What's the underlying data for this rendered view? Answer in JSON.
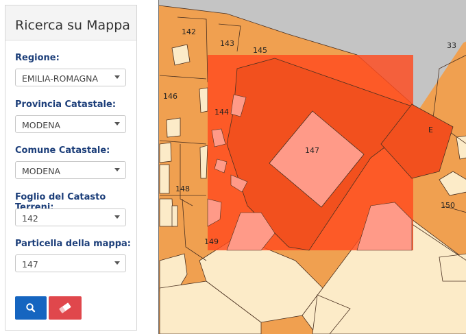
{
  "sidebar": {
    "title": "Ricerca su Mappa",
    "fields": [
      {
        "label": "Regione:",
        "value": "EMILIA-ROMAGNA"
      },
      {
        "label": "Provincia Catastale:",
        "value": "MODENA"
      },
      {
        "label": "Comune Catastale:",
        "value": "MODENA"
      },
      {
        "label": "Foglio del Catasto Terreni:",
        "value": "142"
      },
      {
        "label": "Particella della mappa:",
        "value": "147"
      }
    ],
    "buttons": {
      "search_icon": "search-icon",
      "clear_icon": "eraser-icon"
    }
  },
  "map": {
    "parcel_labels": {
      "p142": "142",
      "p143": "143",
      "p145": "145",
      "p33": "33",
      "p146": "146",
      "p144": "144",
      "p147": "147",
      "pE": "E",
      "p148": "148",
      "p150": "150",
      "p149": "149"
    },
    "colors": {
      "parcel": "#f0a050",
      "building": "#fcebc8",
      "street": "#c4c4c4",
      "highlight": "#ff4a1f",
      "selected_building": "#ff9a88",
      "panel_label": "#1d3f7a",
      "search_button": "#1565c0",
      "clear_button": "#e0474c"
    }
  }
}
